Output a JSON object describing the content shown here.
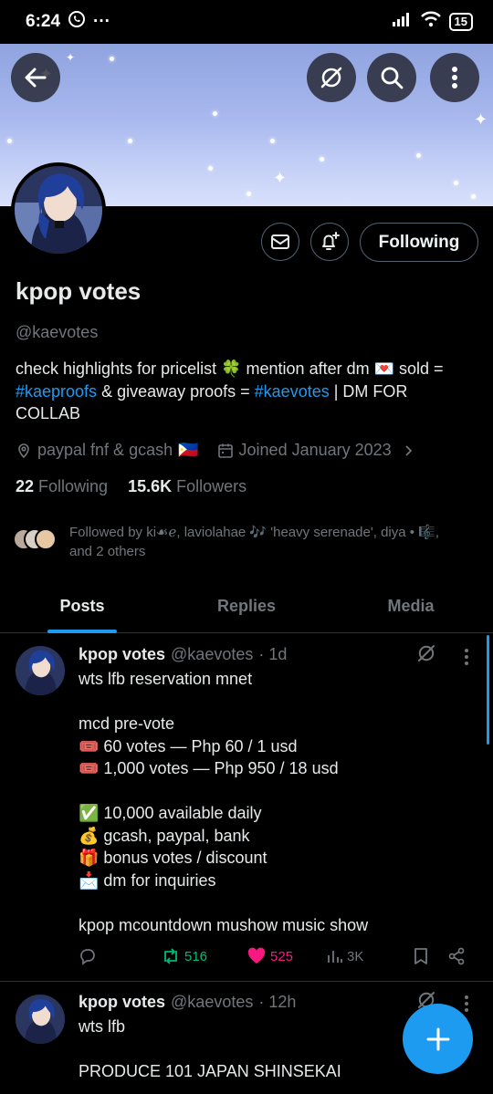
{
  "status_bar": {
    "time": "6:24",
    "battery": "15"
  },
  "profile": {
    "name": "kpop votes",
    "handle": "@kaevotes",
    "bio": {
      "part1": "check highlights for pricelist ",
      "emoji1": "🍀",
      "part2": " mention after dm ",
      "emoji2": "💌",
      "part3": " sold = ",
      "tag1": "#kaeproofs",
      "part4": " & giveaway proofs = ",
      "tag2": "#kaevotes",
      "part5": " | DM FOR COLLAB"
    },
    "location": "paypal fnf & gcash",
    "location_flag": "🇵🇭",
    "joined": "Joined January 2023",
    "following_count": "22",
    "following_label": "Following",
    "followers_count": "15.6K",
    "followers_label": "Followers",
    "followed_by": "Followed by ki☙ℯ, laviolahae 🎶 'heavy serenade', diya • 🎼, and 2 others",
    "following_button": "Following"
  },
  "tabs": [
    "Posts",
    "Replies",
    "Media"
  ],
  "posts": [
    {
      "name": "kpop votes",
      "handle": "@kaevotes",
      "time": "· 1d",
      "lines": [
        "wts lfb reservation mnet",
        "",
        "mcd pre-vote",
        "🎟️ 60 votes — Php 60 / 1 usd",
        "🎟️ 1,000 votes — Php 950 / 18 usd",
        "",
        "✅ 10,000 available daily",
        "💰 gcash, paypal, bank",
        "🎁 bonus votes / discount",
        "📩 dm for inquiries",
        "",
        "kpop mcountdown mushow music show"
      ],
      "reposts": "516",
      "likes": "525",
      "views": "3K"
    },
    {
      "name": "kpop votes",
      "handle": "@kaevotes",
      "time": "· 12h",
      "lines": [
        "wts lfb",
        "",
        "PRODUCE 101 JAPAN SHINSEKAI"
      ]
    }
  ],
  "colors": {
    "accent": "#1d9bf0",
    "repost": "#00ba7c",
    "like": "#f91880",
    "muted": "#71767b"
  }
}
